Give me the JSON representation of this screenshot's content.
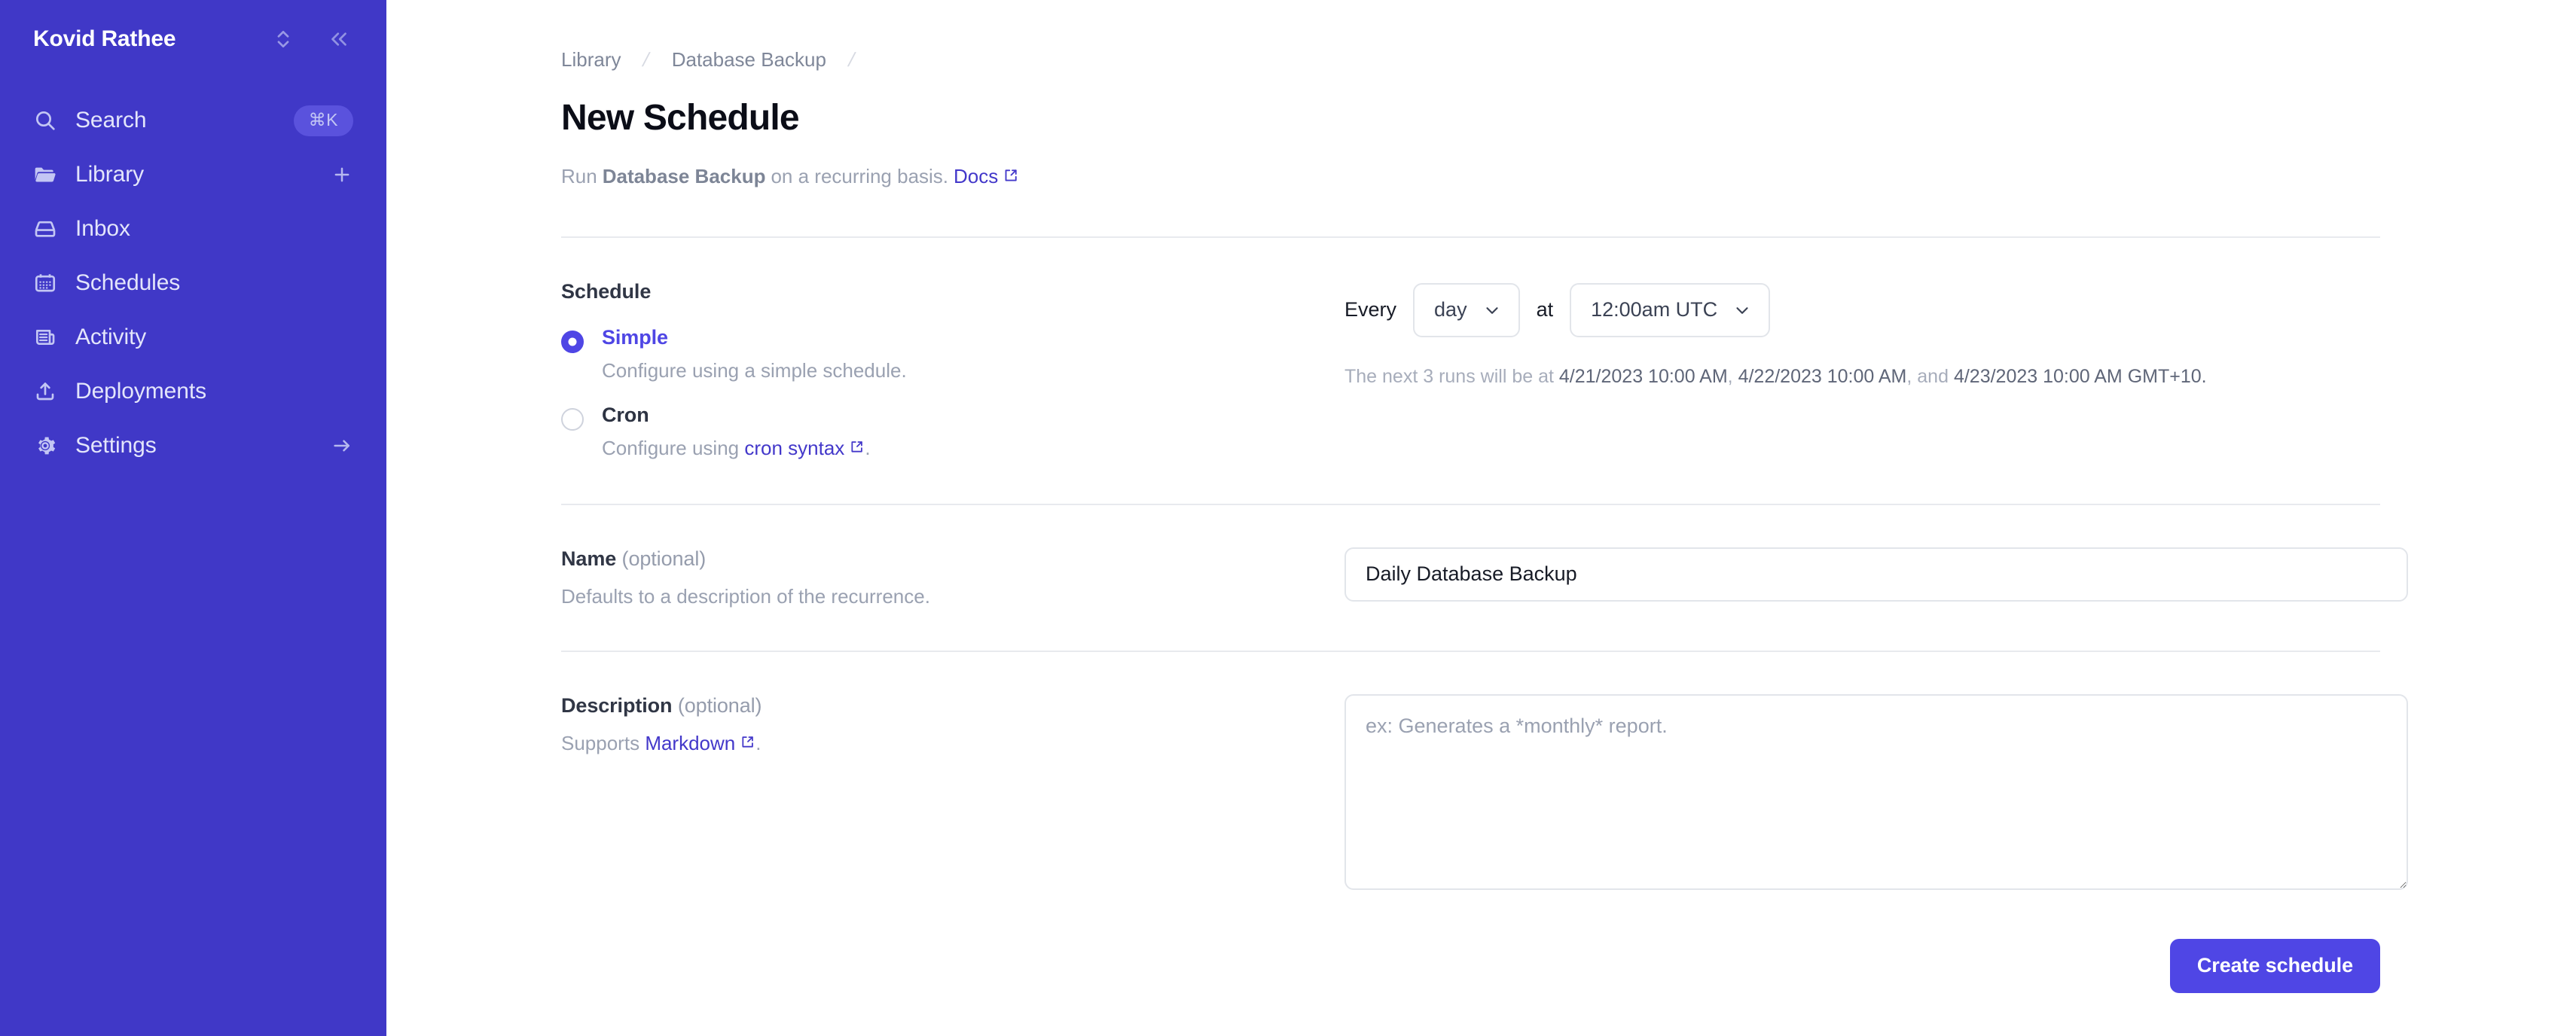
{
  "sidebar": {
    "workspace_name": "Kovid Rathee",
    "header_icons": [
      {
        "name": "workspace-switcher-icon"
      },
      {
        "name": "collapse-sidebar-icon"
      }
    ],
    "items": [
      {
        "label": "Search",
        "icon": "search-icon",
        "badge": "⌘K"
      },
      {
        "label": "Library",
        "icon": "folder-icon",
        "action_icon": "plus-icon"
      },
      {
        "label": "Inbox",
        "icon": "inbox-icon"
      },
      {
        "label": "Schedules",
        "icon": "calendar-icon"
      },
      {
        "label": "Activity",
        "icon": "activity-icon"
      },
      {
        "label": "Deployments",
        "icon": "upload-icon"
      },
      {
        "label": "Settings",
        "icon": "gear-icon",
        "action_icon": "arrow-right-icon"
      }
    ]
  },
  "breadcrumb": {
    "items": [
      "Library",
      "Database Backup"
    ],
    "separator": "/"
  },
  "page": {
    "title": "New Schedule",
    "subtitle_prefix": "Run",
    "subtitle_strong": "Database Backup",
    "subtitle_suffix": "on a recurring basis.",
    "docs_link": "Docs"
  },
  "schedule": {
    "label": "Schedule",
    "options": [
      {
        "title": "Simple",
        "desc": "Configure using a simple schedule.",
        "selected": true
      },
      {
        "title": "Cron",
        "desc_prefix": "Configure using",
        "desc_link": "cron syntax",
        "desc_suffix": ".",
        "selected": false
      }
    ],
    "every_word": "Every",
    "frequency_value": "day",
    "at_word": "at",
    "time_value": "12:00am UTC",
    "next_runs_prefix": "The next 3 runs will be at",
    "next_runs_dates": [
      "4/21/2023 10:00 AM",
      "4/22/2023 10:00 AM",
      "4/23/2023 10:00 AM GMT+10."
    ],
    "next_runs_sep": ",",
    "next_runs_and": "and"
  },
  "name_field": {
    "label": "Name",
    "optional": "(optional)",
    "help": "Defaults to a description of the recurrence.",
    "value": "Daily Database Backup",
    "placeholder": ""
  },
  "description_field": {
    "label": "Description",
    "optional": "(optional)",
    "help_prefix": "Supports",
    "help_link": "Markdown",
    "help_suffix": ".",
    "value": "",
    "placeholder": "ex: Generates a *monthly* report."
  },
  "actions": {
    "submit_label": "Create schedule"
  },
  "colors": {
    "sidebar_bg": "#4038c7",
    "accent": "#4f46e5",
    "link": "#4338ca",
    "muted_text": "#9aa1b1",
    "border": "#e2e5ea"
  }
}
